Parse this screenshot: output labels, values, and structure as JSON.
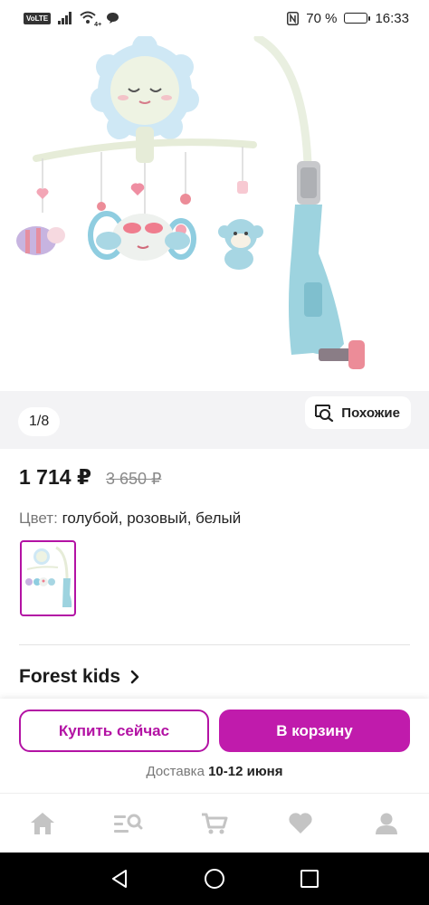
{
  "status_bar": {
    "volte": "VoLTE",
    "network": "4+",
    "battery_text": "70 %",
    "battery_level": 0.7,
    "time": "16:33"
  },
  "gallery": {
    "counter": "1/8",
    "similar_label": "Похожие"
  },
  "product": {
    "price": "1 714 ₽",
    "old_price": "3 650 ₽",
    "color_label": "Цвет:",
    "color_value": "голубой, розовый, белый",
    "brand": "Forest kids"
  },
  "actions": {
    "buy_now": "Купить сейчас",
    "add_to_cart": "В корзину",
    "delivery_label": "Доставка",
    "delivery_dates": "10-12 июня"
  },
  "bottom_nav": [
    "home-icon",
    "catalog-search-icon",
    "cart-icon",
    "heart-icon",
    "profile-icon"
  ],
  "colors": {
    "accent": "#b312a4",
    "accent_fill": "#c01bac",
    "nav_icon": "#c4c4c4"
  }
}
